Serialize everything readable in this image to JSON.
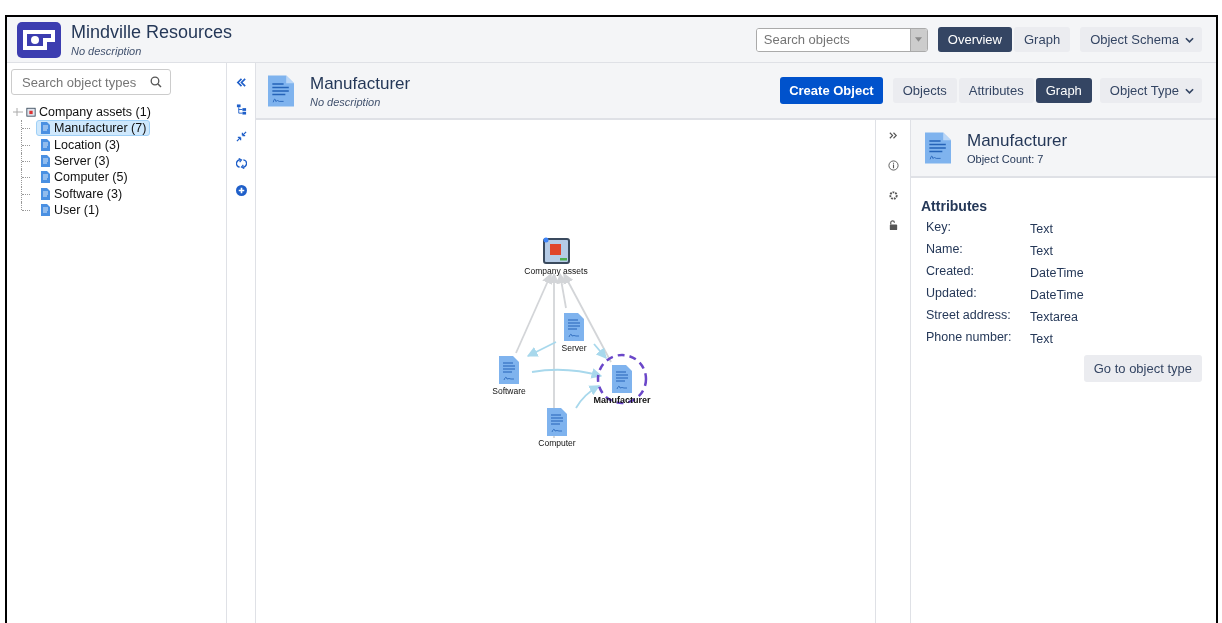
{
  "header": {
    "title": "Mindville Resources",
    "description": "No description",
    "search": {
      "placeholder": "Search objects"
    },
    "view_tabs": [
      {
        "label": "Overview",
        "selected": true
      },
      {
        "label": "Graph",
        "selected": false
      }
    ],
    "schema_menu": "Object Schema"
  },
  "sidebar": {
    "search": {
      "placeholder": "Search object types"
    },
    "tree": {
      "label": "Company assets (1)",
      "children": [
        {
          "label": "Manufacturer (7)",
          "selected": true
        },
        {
          "label": "Location (3)",
          "selected": false
        },
        {
          "label": "Server (3)",
          "selected": false
        },
        {
          "label": "Computer (5)",
          "selected": false
        },
        {
          "label": "Software (3)",
          "selected": false
        },
        {
          "label": "User (1)",
          "selected": false
        }
      ]
    }
  },
  "object_type": {
    "title": "Manufacturer",
    "description": "No description",
    "create_button": "Create Object",
    "tabs": [
      {
        "label": "Objects",
        "selected": false
      },
      {
        "label": "Attributes",
        "selected": false
      },
      {
        "label": "Graph",
        "selected": true
      }
    ],
    "type_menu": "Object Type"
  },
  "graph": {
    "nodes": [
      {
        "label": "Company assets",
        "kind": "root",
        "selected": false
      },
      {
        "label": "Server",
        "kind": "type",
        "selected": false
      },
      {
        "label": "Software",
        "kind": "type",
        "selected": false
      },
      {
        "label": "Manufacturer",
        "kind": "type",
        "selected": true
      },
      {
        "label": "Computer",
        "kind": "type",
        "selected": false
      }
    ]
  },
  "details": {
    "title": "Manufacturer",
    "count": "Object Count: 7",
    "section": "Attributes",
    "attributes": [
      {
        "name": "Key:",
        "type": "Text"
      },
      {
        "name": "Name:",
        "type": "Text"
      },
      {
        "name": "Created:",
        "type": "DateTime"
      },
      {
        "name": "Updated:",
        "type": "DateTime"
      },
      {
        "name": "Street address:",
        "type": "Textarea"
      },
      {
        "name": "Phone number:",
        "type": "Text"
      }
    ],
    "button": "Go to object type"
  }
}
